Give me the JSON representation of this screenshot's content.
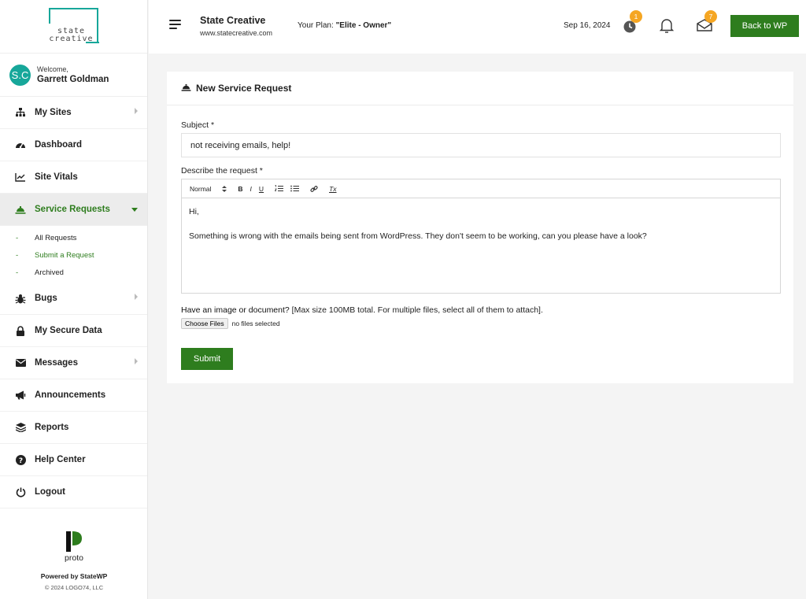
{
  "brand": {
    "line1": "state",
    "line2": "creative"
  },
  "user": {
    "initials": "S.C",
    "welcome": "Welcome,",
    "name": "Garrett Goldman"
  },
  "nav": {
    "my_sites": "My Sites",
    "dashboard": "Dashboard",
    "site_vitals": "Site Vitals",
    "service_requests": "Service Requests",
    "sub": {
      "all": "All Requests",
      "submit": "Submit a Request",
      "archived": "Archived",
      "dash": "-"
    },
    "bugs": "Bugs",
    "secure_data": "My Secure Data",
    "messages": "Messages",
    "announcements": "Announcements",
    "reports": "Reports",
    "help": "Help Center",
    "logout": "Logout"
  },
  "footer": {
    "proto": "proto",
    "powered": "Powered by StateWP",
    "copyright": "© 2024 LOGO74, LLC"
  },
  "header": {
    "site_name": "State Creative",
    "site_url": "www.statecreative.com",
    "plan_label": "Your Plan: ",
    "plan_value": "\"Elite - Owner\"",
    "date": "Sep 16, 2024",
    "clock_badge": "1",
    "mail_badge": "7",
    "back_label": "Back to WP"
  },
  "form": {
    "title": "New Service Request",
    "subject_label": "Subject *",
    "subject_value": "not receiving emails, help!",
    "describe_label": "Describe the request *",
    "toolbar": {
      "format": "Normal",
      "bold": "B",
      "italic": "I",
      "underline": "U",
      "clear": "Tx"
    },
    "body_line1": "Hi,",
    "body_line2": "Something is wrong with the emails being sent from WordPress. They don't seem to be working, can you please have a look?",
    "attach_label": "Have an image or document?",
    "attach_hint": " [Max size 100MB total. For multiple files, select all of them to attach].",
    "choose_files": "Choose Files",
    "no_files": "no files selected",
    "submit_label": "Submit"
  },
  "colors": {
    "accent": "#2e7d1e",
    "teal": "#17a79a",
    "badge": "#f5a623"
  }
}
